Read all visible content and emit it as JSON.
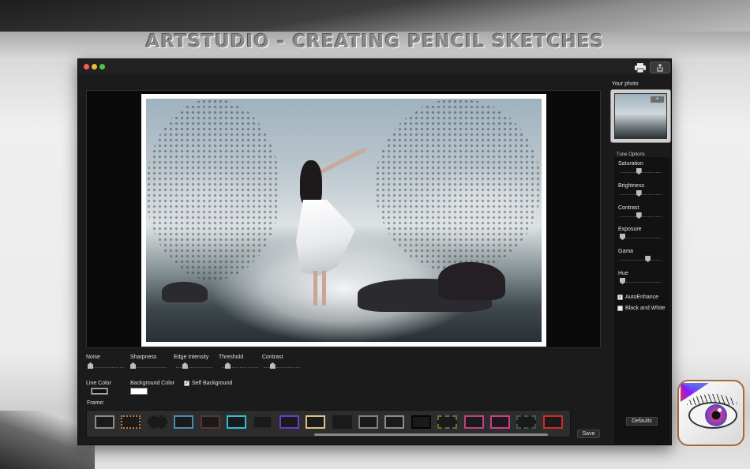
{
  "banner": {
    "text": "ARTSTUDIO - CREATING PENCIL SKETCHES"
  },
  "toolbar": {
    "print_icon": "printer-icon",
    "share_icon": "share-icon"
  },
  "effect_controls": {
    "sliders": [
      {
        "label": "Noise",
        "value": 0.0
      },
      {
        "label": "Sharpness",
        "value": 0.0
      },
      {
        "label": "Edge Intensity",
        "value": 0.2
      },
      {
        "label": "Threshold",
        "value": 0.1
      },
      {
        "label": "Contrast",
        "value": 0.2
      }
    ],
    "line_color": {
      "label": "Line Color",
      "value": "#111111"
    },
    "background_color": {
      "label": "Background Color",
      "value": "#ffffff"
    },
    "self_background": {
      "label": "Self Background",
      "checked": true
    },
    "frame_label": "Frame:",
    "frames": [
      {
        "name": "plain-gray",
        "color": "#8a8a8a"
      },
      {
        "name": "rough-orange",
        "color": "#c8783a"
      },
      {
        "name": "dark-scalloped",
        "color": "#2a2a2a"
      },
      {
        "name": "blue-brush",
        "color": "#4a8ab0"
      },
      {
        "name": "dark-red",
        "color": "#5a3535"
      },
      {
        "name": "cyan",
        "color": "#2fbfd0"
      },
      {
        "name": "dark-plain",
        "color": "#2a2a2a"
      },
      {
        "name": "purple",
        "color": "#6a3acb"
      },
      {
        "name": "gold",
        "color": "#e0c080"
      },
      {
        "name": "black-rough",
        "color": "#1a1a1a"
      },
      {
        "name": "gray",
        "color": "#808080"
      },
      {
        "name": "gray-light",
        "color": "#8c8c8c"
      },
      {
        "name": "black",
        "color": "#050505"
      },
      {
        "name": "olive-dashed",
        "color": "#6a6a3a"
      },
      {
        "name": "rainbow",
        "color": "#c04080"
      },
      {
        "name": "pink",
        "color": "#d03a8a"
      },
      {
        "name": "green-dashed",
        "color": "#3a5a4a"
      },
      {
        "name": "red-brackets",
        "color": "#d02a2a"
      }
    ],
    "save_label": "Save"
  },
  "right_panel": {
    "your_photo_label": "Your photo",
    "add_photo_icon": "plus-icon",
    "tune_options_label": "Tune Options",
    "tune_sliders": [
      {
        "label": "Saturation",
        "value": 0.45
      },
      {
        "label": "Brightness",
        "value": 0.45
      },
      {
        "label": "Contrast",
        "value": 0.45
      },
      {
        "label": "Exposure",
        "value": 0.0
      },
      {
        "label": "Gama",
        "value": 0.7
      },
      {
        "label": "Hue",
        "value": 0.0
      }
    ],
    "auto_enhance": {
      "label": "AutoEnhance",
      "checked": true
    },
    "black_and_white": {
      "label": "Black and White",
      "checked": false
    },
    "defaults_label": "Defaults"
  },
  "app_icon": {
    "name": "artstudio-eye-icon"
  }
}
